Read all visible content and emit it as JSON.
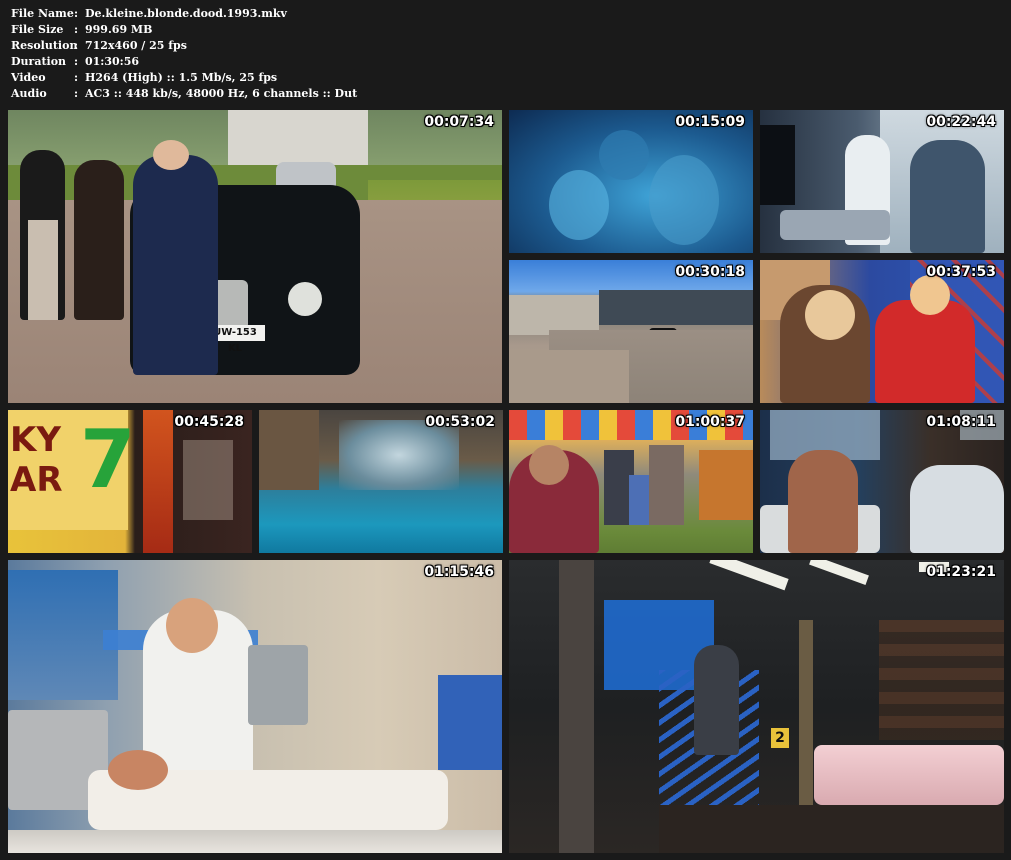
{
  "info": [
    {
      "key": "File Name",
      "value": "De.kleine.blonde.dood.1993.mkv"
    },
    {
      "key": "File Size",
      "value": "999.69 MB"
    },
    {
      "key": "Resolution",
      "value": "712x460 / 25 fps"
    },
    {
      "key": "Duration",
      "value": "01:30:56"
    },
    {
      "key": "Video",
      "value": "H264 (High) :: 1.5 Mb/s, 25 fps"
    },
    {
      "key": "Audio",
      "value": "AC3 :: 448 kb/s, 48000 Hz, 6 channels :: Dut"
    }
  ],
  "thumbnails": [
    {
      "timestamp": "00:07:34",
      "plate": "UW-153 KL"
    },
    {
      "timestamp": "00:15:09"
    },
    {
      "timestamp": "00:22:44"
    },
    {
      "timestamp": "00:30:18"
    },
    {
      "timestamp": "00:37:53"
    },
    {
      "timestamp": "00:45:28",
      "sign": "KY\nAR",
      "number": "7"
    },
    {
      "timestamp": "00:53:02"
    },
    {
      "timestamp": "01:00:37"
    },
    {
      "timestamp": "01:08:11"
    },
    {
      "timestamp": "01:15:46"
    },
    {
      "timestamp": "01:23:21",
      "sign": "2"
    }
  ],
  "colors": {
    "background": "#1a1a1a",
    "text": "#ffffff"
  }
}
